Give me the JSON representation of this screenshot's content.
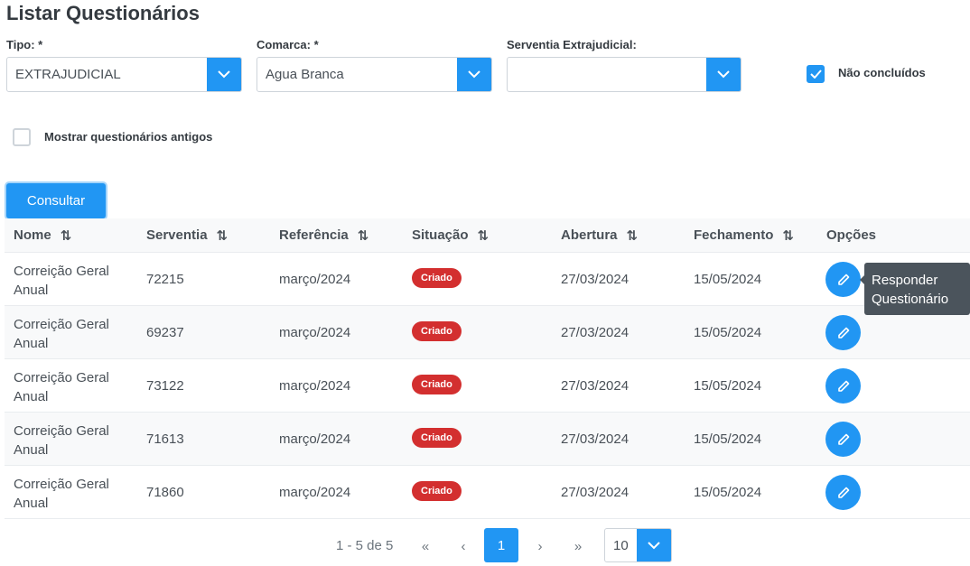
{
  "page": {
    "title": "Listar Questionários"
  },
  "filters": {
    "tipo": {
      "label": "Tipo: *",
      "value": "EXTRAJUDICIAL"
    },
    "comarca": {
      "label": "Comarca: *",
      "value": "Agua Branca"
    },
    "serventia": {
      "label": "Serventia Extrajudicial:",
      "value": ""
    },
    "nao_concluidos": {
      "label": "Não concluídos",
      "checked": true
    },
    "mostrar_antigos": {
      "label": "Mostrar questionários antigos",
      "checked": false
    },
    "consultar_label": "Consultar"
  },
  "table": {
    "columns": [
      "Nome",
      "Serventia",
      "Referência",
      "Situação",
      "Abertura",
      "Fechamento",
      "Opções"
    ],
    "rows": [
      {
        "nome": "Correição Geral Anual",
        "serventia": "72215",
        "referencia": "março/2024",
        "situacao": "Criado",
        "abertura": "27/03/2024",
        "fechamento": "15/05/2024"
      },
      {
        "nome": "Correição Geral Anual",
        "serventia": "69237",
        "referencia": "março/2024",
        "situacao": "Criado",
        "abertura": "27/03/2024",
        "fechamento": "15/05/2024"
      },
      {
        "nome": "Correição Geral Anual",
        "serventia": "73122",
        "referencia": "março/2024",
        "situacao": "Criado",
        "abertura": "27/03/2024",
        "fechamento": "15/05/2024"
      },
      {
        "nome": "Correição Geral Anual",
        "serventia": "71613",
        "referencia": "março/2024",
        "situacao": "Criado",
        "abertura": "27/03/2024",
        "fechamento": "15/05/2024"
      },
      {
        "nome": "Correição Geral Anual",
        "serventia": "71860",
        "referencia": "março/2024",
        "situacao": "Criado",
        "abertura": "27/03/2024",
        "fechamento": "15/05/2024"
      }
    ]
  },
  "tooltip": {
    "text": "Responder Questionário"
  },
  "pagination": {
    "summary": "1 - 5 de 5",
    "current_page": "1",
    "rows_per_page": "10"
  },
  "colors": {
    "primary": "#2196f3",
    "danger": "#d32f2f",
    "tooltip": "#4b545c"
  }
}
